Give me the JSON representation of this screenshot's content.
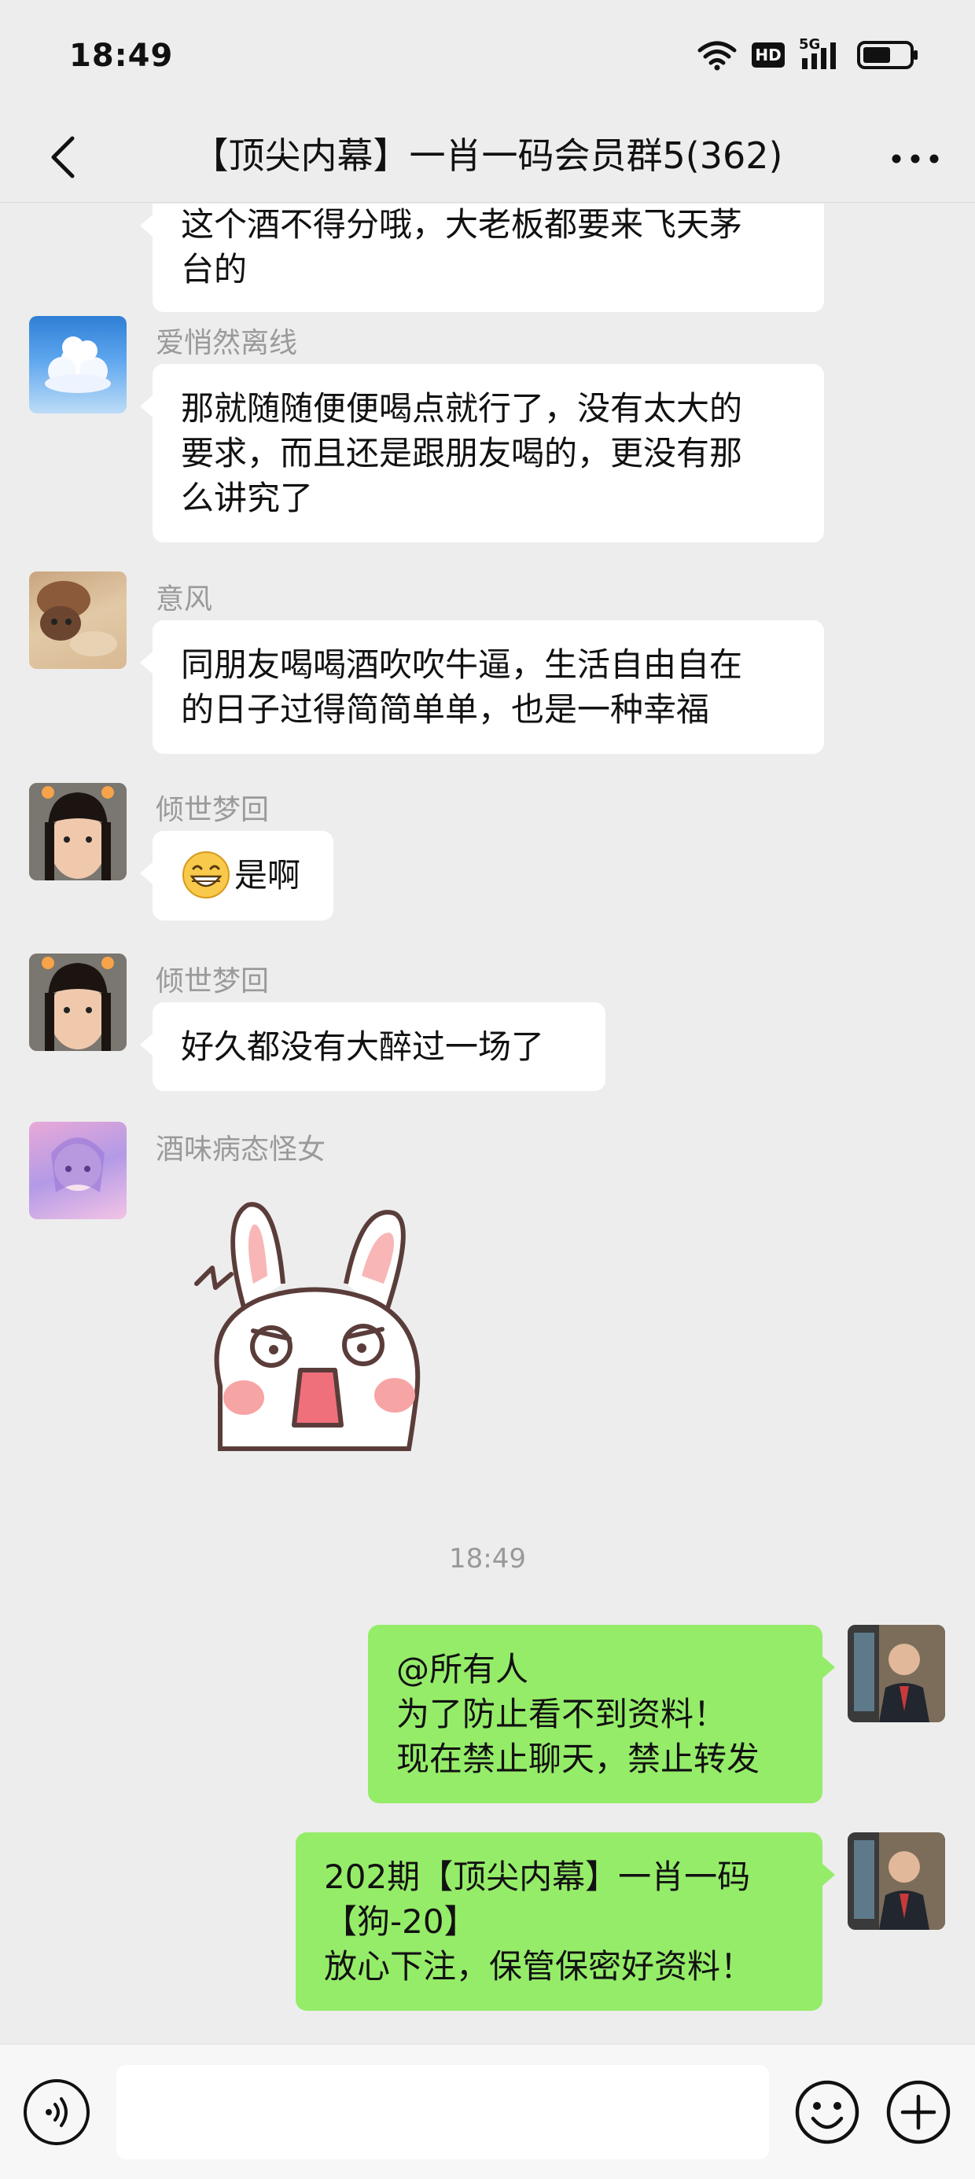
{
  "status_bar": {
    "time": "18:49",
    "network_badge": "HD",
    "signal_badge": "5G"
  },
  "header": {
    "title": "【顶尖内幕】一肖一码会员群5(362)"
  },
  "messages": [
    {
      "side": "left",
      "lines": [
        "这个酒不得分哦，大老板都要来飞天茅",
        "台的"
      ]
    },
    {
      "side": "left",
      "sender": "爱悄然离线",
      "avatar": "cloud-avatar",
      "lines": [
        "那就随随便便喝点就行了，没有太大的",
        "要求，而且还是跟朋友喝的，更没有那",
        "么讲究了"
      ]
    },
    {
      "side": "left",
      "sender": "意风",
      "avatar": "dog-avatar",
      "lines": [
        "同朋友喝喝酒吹吹牛逼，生活自由自在",
        "的日子过得简简单单，也是一种幸福"
      ]
    },
    {
      "side": "left",
      "sender": "倾世梦回",
      "avatar": "girl-avatar",
      "emoji": "grin-emoji",
      "lines": [
        "是啊"
      ]
    },
    {
      "side": "left",
      "sender": "倾世梦回",
      "avatar": "girl-avatar",
      "lines": [
        "好久都没有大醉过一场了"
      ]
    },
    {
      "side": "left",
      "sender": "酒味病态怪女",
      "avatar": "anime-avatar",
      "sticker": "angry-rabbit-sticker"
    },
    {
      "type": "timestamp",
      "text": "18:49"
    },
    {
      "side": "right",
      "avatar": "man-avatar",
      "lines": [
        "@所有人",
        "为了防止看不到资料！",
        "现在禁止聊天，禁止转发"
      ]
    },
    {
      "side": "right",
      "avatar": "man-avatar",
      "lines": [
        "202期【顶尖内幕】一肖一码",
        "【狗-20】",
        "放心下注，保管保密好资料！"
      ]
    }
  ],
  "input_bar": {
    "placeholder": ""
  },
  "colors": {
    "background": "#ededed",
    "my_bubble": "#95ec69",
    "other_bubble": "#ffffff",
    "name_gray": "#9a9a9a"
  }
}
